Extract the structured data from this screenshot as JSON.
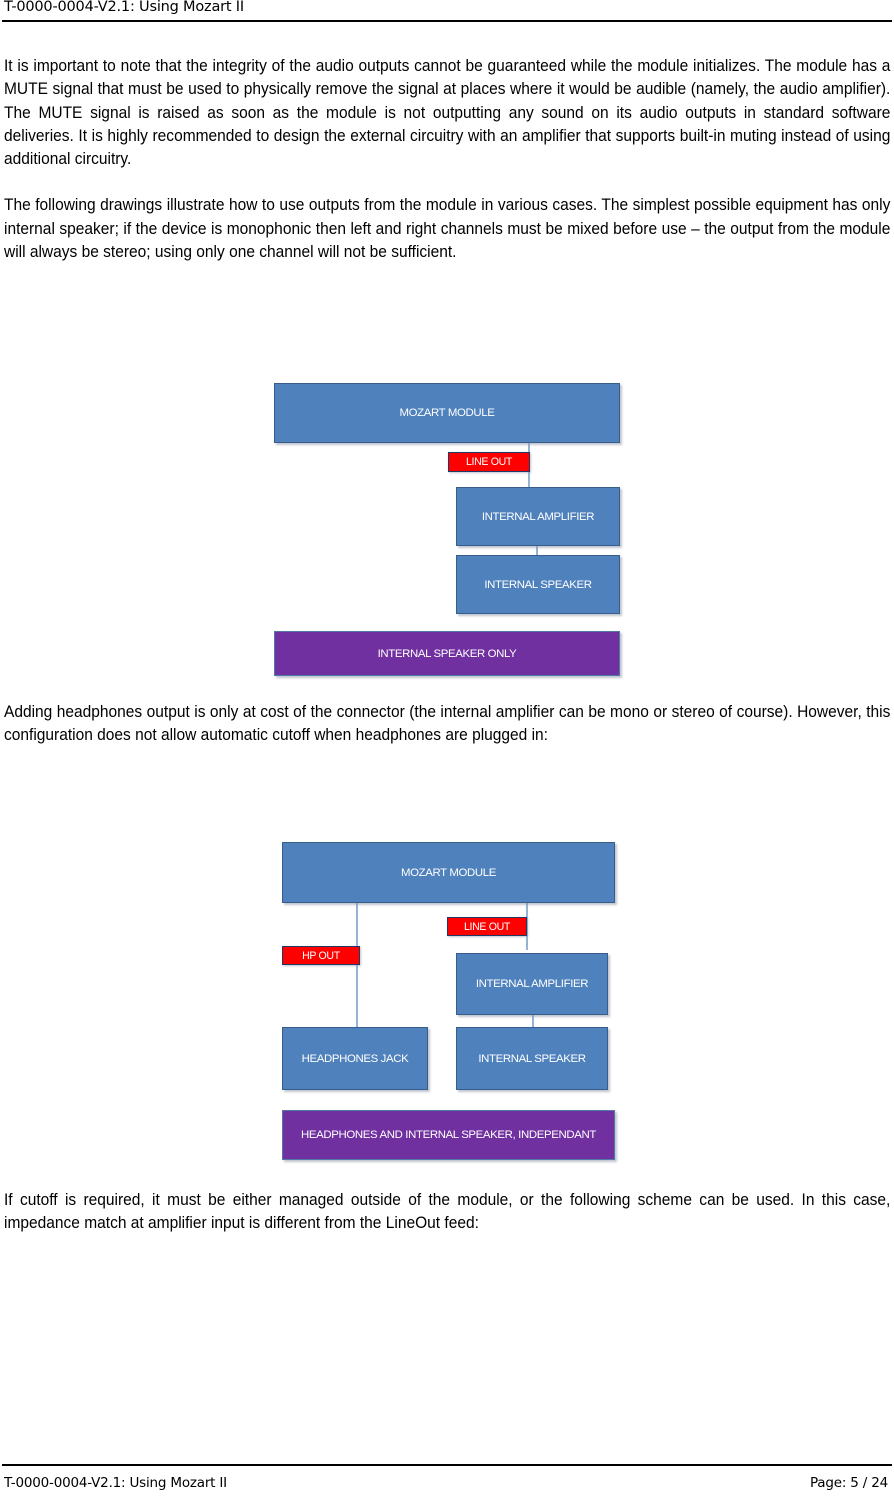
{
  "header": {
    "title": "T-0000-0004-V2.1: Using Mozart II"
  },
  "footer": {
    "doc_ref": "T-0000-0004-V2.1: Using Mozart II",
    "page_label": "Page: 5 / 24"
  },
  "body": {
    "paragraph_1": "It is important to note that the integrity of the audio outputs cannot be guaranteed while the module initializes. The module has a MUTE signal that must be used to physically remove the signal at places where it would be audible (namely, the audio amplifier). The MUTE signal is raised as soon as the module is not outputting any sound on its audio outputs in standard software deliveries. It is highly recommended to design the external circuitry with an amplifier that supports built-in muting instead of using additional circuitry.",
    "paragraph_2": "The following drawings illustrate how to use outputs from the module in various cases. The simplest possible equipment has only internal speaker; if the device is monophonic then left and right channels must be mixed before use – the output from the module will always be stereo; using only one channel will not be sufficient.",
    "paragraph_3": "Adding headphones output is only at cost of the connector (the internal amplifier can be mono or stereo of course). However, this configuration does not allow automatic cutoff when headphones are plugged in:",
    "paragraph_4": "If cutoff is required, it must be either managed outside of the module, or the following scheme can be used. In this case, impedance match at amplifier input is different from the LineOut feed:"
  },
  "colors": {
    "node_blue": "#4F81BD",
    "node_blue_border": "#385D8A",
    "node_purple": "#7030A0",
    "signal_red": "#FF0000",
    "connector_blue": "#95B3D7",
    "text_white": "#FFFFFF"
  },
  "diagram_1": {
    "caption": "INTERNAL SPEAKER ONLY",
    "nodes": {
      "mozart_module": "MOZART MODULE",
      "line_out": "LINE OUT",
      "internal_amplifier": "INTERNAL AMPLIFIER",
      "internal_speaker": "INTERNAL SPEAKER"
    }
  },
  "diagram_2": {
    "caption": "HEADPHONES AND INTERNAL SPEAKER, INDEPENDANT",
    "nodes": {
      "mozart_module": "MOZART MODULE",
      "line_out": "LINE OUT",
      "hp_out": "HP OUT",
      "internal_amplifier": "INTERNAL AMPLIFIER",
      "internal_speaker": "INTERNAL SPEAKER",
      "headphones_jack": "HEADPHONES JACK"
    }
  }
}
